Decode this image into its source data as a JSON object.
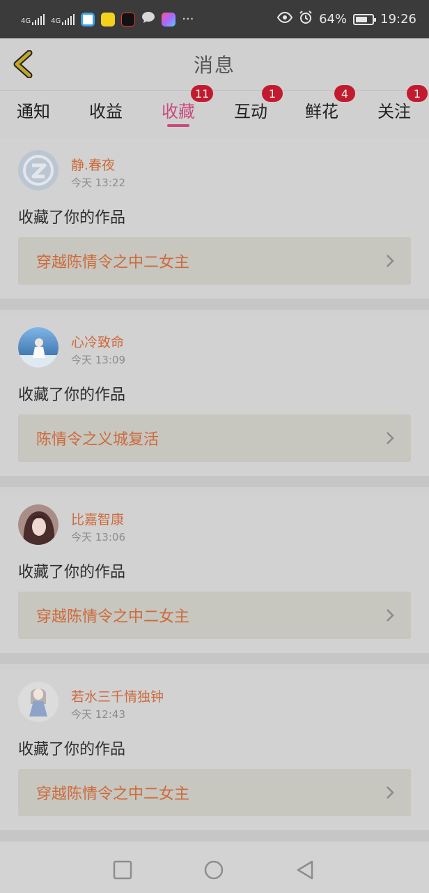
{
  "status_bar": {
    "network1": "4G",
    "network2": "4G",
    "more": "···",
    "battery": "64%",
    "time": "19:26",
    "icons": [
      "eye-icon",
      "alarm-icon",
      "battery-icon"
    ]
  },
  "header": {
    "title": "消息",
    "back_icon": "chevron-left-icon"
  },
  "tabs": [
    {
      "label": "通知",
      "badge": ""
    },
    {
      "label": "收益",
      "badge": ""
    },
    {
      "label": "收藏",
      "badge": "11",
      "active": true
    },
    {
      "label": "互动",
      "badge": "1"
    },
    {
      "label": "鲜花",
      "badge": "4"
    },
    {
      "label": "关注",
      "badge": "1"
    }
  ],
  "messages": [
    {
      "user": "静.春夜",
      "time": "今天 13:22",
      "action": "收藏了你的作品",
      "work": "穿越陈情令之中二女主"
    },
    {
      "user": "心冷致命",
      "time": "今天 13:09",
      "action": "收藏了你的作品",
      "work": "陈情令之义城复活"
    },
    {
      "user": "比嘉智康",
      "time": "今天 13:06",
      "action": "收藏了你的作品",
      "work": "穿越陈情令之中二女主"
    },
    {
      "user": "若水三千情独钟",
      "time": "今天 12:43",
      "action": "收藏了你的作品",
      "work": "穿越陈情令之中二女主"
    }
  ],
  "colors": {
    "accent": "#c94a7c",
    "name_orange": "#cc6a3c",
    "badge_red": "#c21a2f"
  }
}
